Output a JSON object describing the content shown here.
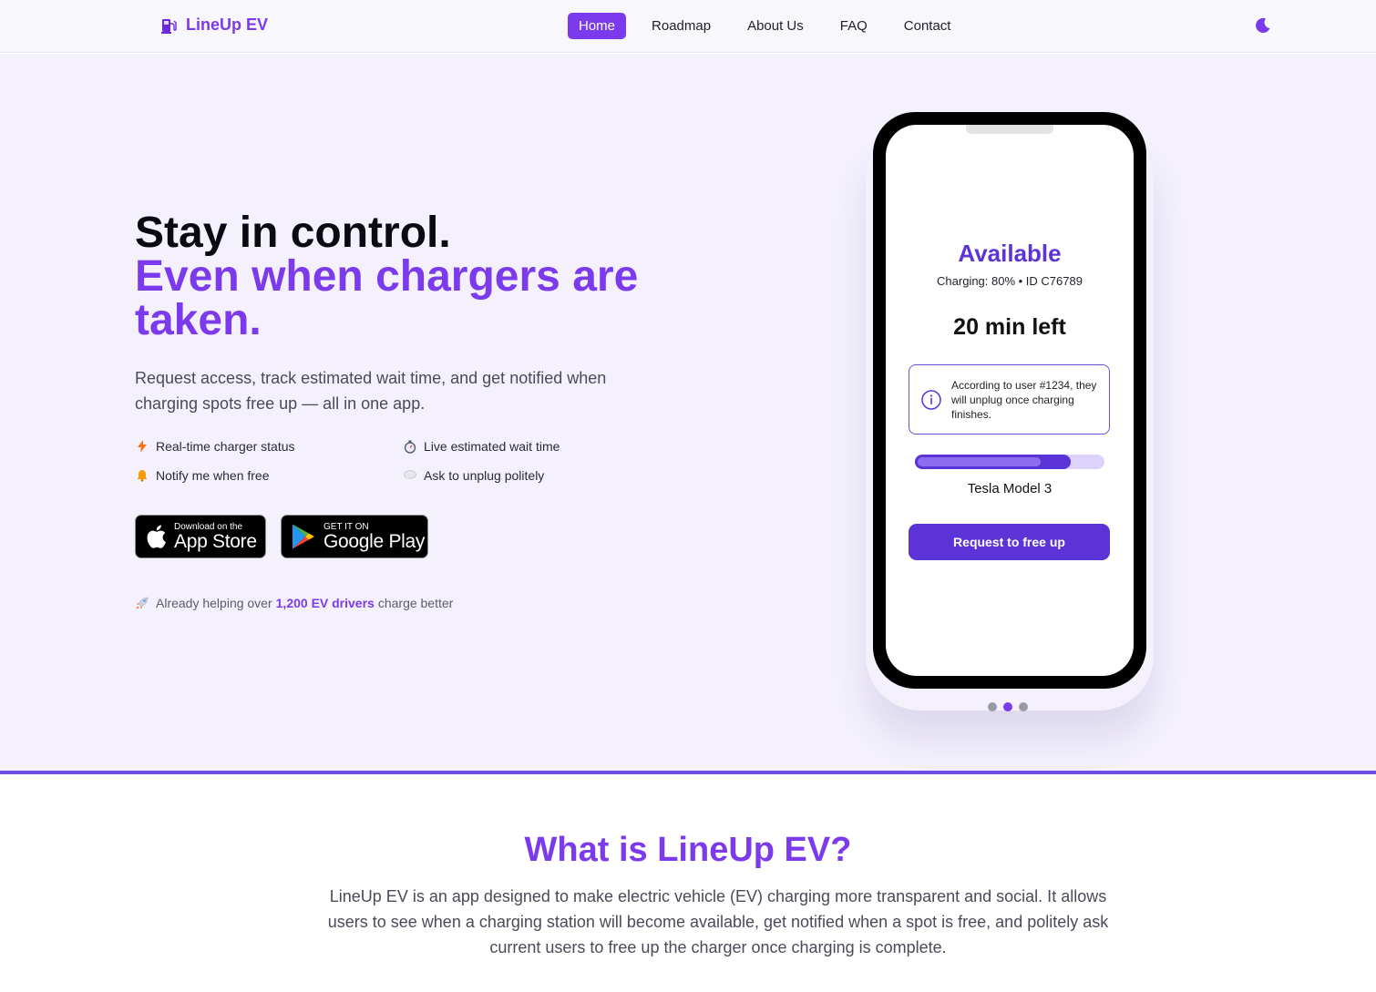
{
  "nav": {
    "brand": "LineUp EV",
    "links": [
      "Home",
      "Roadmap",
      "About Us",
      "FAQ",
      "Contact"
    ],
    "active": "Home"
  },
  "hero": {
    "title_line1": "Stay in control.",
    "title_line2": "Even when chargers are taken.",
    "subtitle": "Request access, track estimated wait time, and get notified when charging spots free up — all in one app.",
    "features": [
      {
        "icon": "lightning-icon",
        "label": "Real-time charger status"
      },
      {
        "icon": "stopwatch-icon",
        "label": "Live estimated wait time"
      },
      {
        "icon": "bell-icon",
        "label": "Notify me when free"
      },
      {
        "icon": "speech-bubble-icon",
        "label": "Ask to unplug politely"
      }
    ],
    "app_store": {
      "small": "Download on the",
      "big": "App Store"
    },
    "google_play": {
      "small": "GET IT ON",
      "big": "Google Play"
    },
    "trust": {
      "before": "Already helping over",
      "highlight": "1,200 EV drivers",
      "after": "charge better"
    }
  },
  "phone": {
    "status": "Available",
    "meta": "Charging: 80% • ID C76789",
    "time_left": "20 min left",
    "note": "According to user #1234, they will unplug once charging finishes.",
    "progress_fraction": 0.82,
    "car": "Tesla Model 3",
    "button": "Request to free up"
  },
  "carousel": {
    "count": 3,
    "active_index": 1
  },
  "what": {
    "title": "What is LineUp EV?",
    "body": "LineUp EV is an app designed to make electric vehicle (EV) charging more transparent and social. It allows users to see when a charging station will become available, get notified when a spot is free, and politely ask current users to free up the charger once charging is complete."
  },
  "colors": {
    "accent": "#7c3aed",
    "button": "#5b33d6",
    "hero_bg": "#f4f1fd"
  }
}
